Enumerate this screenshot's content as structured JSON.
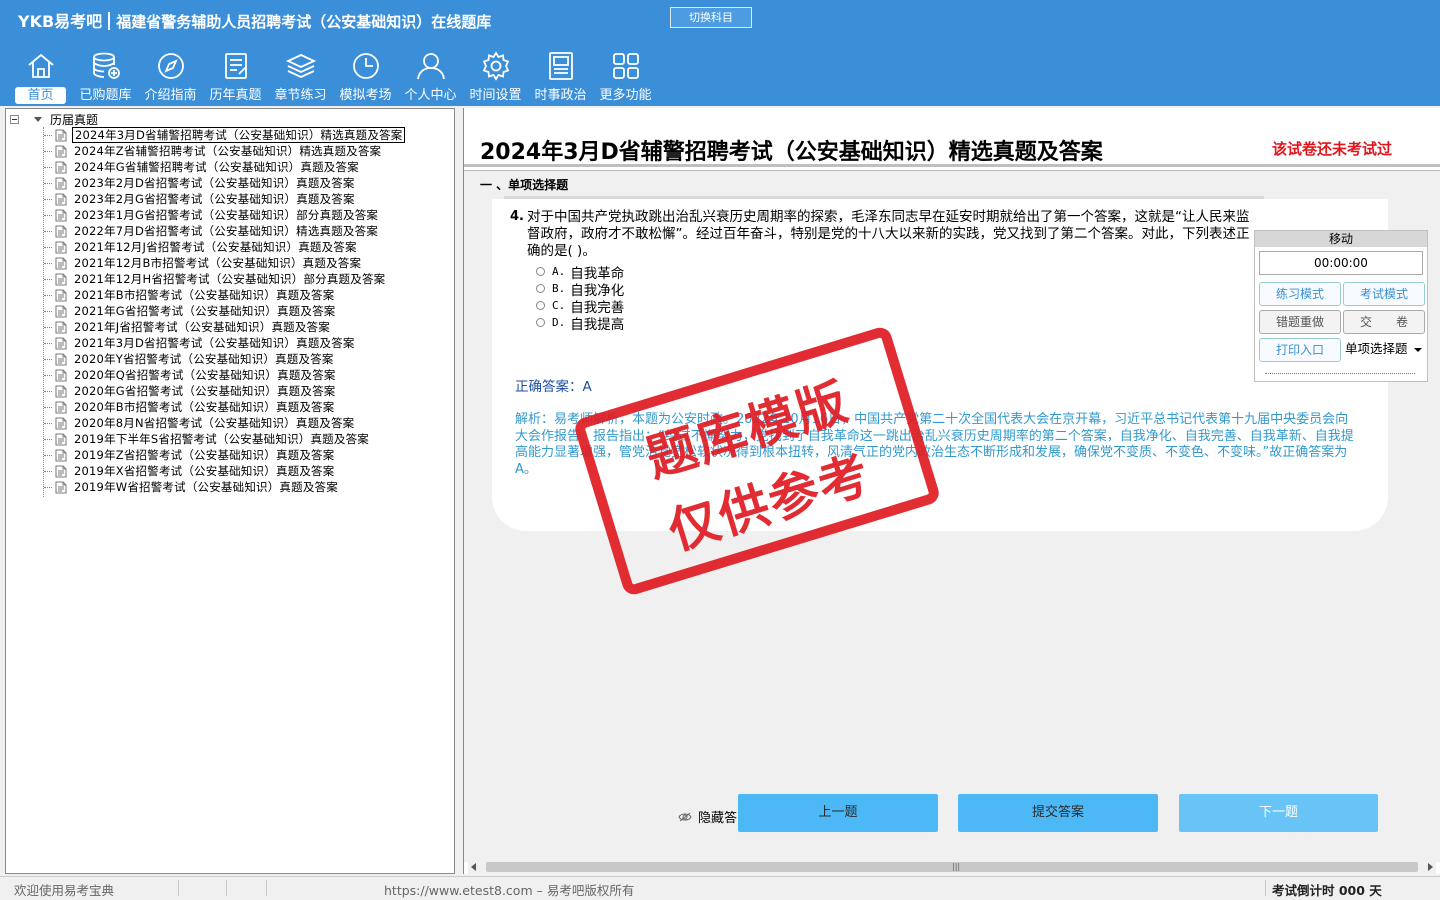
{
  "header": {
    "brand": "YKB易考吧",
    "subtitle": "福建省警务辅助人员招聘考试（公安基础知识）在线题库",
    "switch_label": "切换科目"
  },
  "nav": [
    {
      "label": "首页",
      "icon": "home-icon"
    },
    {
      "label": "已购题库",
      "icon": "database-add-icon"
    },
    {
      "label": "介绍指南",
      "icon": "compass-icon"
    },
    {
      "label": "历年真题",
      "icon": "document-list-icon"
    },
    {
      "label": "章节练习",
      "icon": "layers-icon"
    },
    {
      "label": "模拟考场",
      "icon": "clock-icon"
    },
    {
      "label": "个人中心",
      "icon": "user-icon"
    },
    {
      "label": "时间设置",
      "icon": "gear-icon"
    },
    {
      "label": "时事政治",
      "icon": "book-icon"
    },
    {
      "label": "更多功能",
      "icon": "grid-icon"
    }
  ],
  "tree": {
    "root": "历届真题",
    "items": [
      "2024年3月D省辅警招聘考试（公安基础知识）精选真题及答案",
      "2024年Z省辅警招聘考试（公安基础知识）精选真题及答案",
      "2024年G省辅警招聘考试（公安基础知识）真题及答案",
      "2023年2月D省招警考试（公安基础知识）真题及答案",
      "2023年2月G省招警考试（公安基础知识）真题及答案",
      "2023年1月G省招警考试（公安基础知识）部分真题及答案",
      "2022年7月D省招警考试（公安基础知识）精选真题及答案",
      "2021年12月J省招警考试（公安基础知识）真题及答案",
      "2021年12月B市招警考试（公安基础知识）真题及答案",
      "2021年12月H省招警考试（公安基础知识）部分真题及答案",
      "2021年B市招警考试（公安基础知识）真题及答案",
      "2021年G省招警考试（公安基础知识）真题及答案",
      "2021年J省招警考试（公安基础知识）真题及答案",
      "2021年3月D省招警考试（公安基础知识）真题及答案",
      "2020年Y省招警考试（公安基础知识）真题及答案",
      "2020年Q省招警考试（公安基础知识）真题及答案",
      "2020年G省招警考试（公安基础知识）真题及答案",
      "2020年B市招警考试（公安基础知识）真题及答案",
      "2020年8月N省招警考试（公安基础知识）真题及答案",
      "2019年下半年S省招警考试（公安基础知识）真题及答案",
      "2019年Z省招警考试（公安基础知识）真题及答案",
      "2019年X省招警考试（公安基础知识）真题及答案",
      "2019年W省招警考试（公安基础知识）真题及答案"
    ],
    "selected_index": 0
  },
  "paper": {
    "title": "2024年3月D省辅警招聘考试（公安基础知识）精选真题及答案",
    "status": "该试卷还未考试过",
    "section": "一 、单项选择题"
  },
  "question": {
    "number": "4.",
    "text": "对于中国共产党执政跳出治乱兴衰历史周期率的探索，毛泽东同志早在延安时期就给出了第一个答案，这就是“让人民来监督政府，政府才不敢松懈”。经过百年奋斗，特别是党的十八大以来新的实践，党又找到了第二个答案。对此，下列表述正确的是( )。",
    "options": [
      {
        "key": "A.",
        "text": "自我革命"
      },
      {
        "key": "B.",
        "text": "自我净化"
      },
      {
        "key": "C.",
        "text": "自我完善"
      },
      {
        "key": "D.",
        "text": "自我提高"
      }
    ],
    "answer": "正确答案：A",
    "analysis": "解析：易考师解析，本题为公安时政。2022年10月16日，中国共产党第二十次全国代表大会在京开幕，习近平总书记代表第十九届中央委员会向大会作报告。报告指出：“经过不懈努力，党找到了自我革命这一跳出治乱兴衰历史周期率的第二个答案，自我净化、自我完善、自我革新、自我提高能力显著增强，管党治党宽松软状况得到根本扭转，风清气正的党内政治生态不断形成和发展，确保党不变质、不变色、不变味。”故正确答案为A。"
  },
  "panel": {
    "move": "移动",
    "timer": "00:00:00",
    "practice": "练习模式",
    "exam": "考试模式",
    "redo": "错题重做",
    "submit": "交　　卷",
    "print": "打印入口",
    "select": "单项选择题"
  },
  "watermark": {
    "line1": "题库模版",
    "line2": "仅供参考"
  },
  "controls": {
    "hide_answer": "隐藏答",
    "prev": "上一题",
    "submit_answer": "提交答案",
    "next": "下一题"
  },
  "status": {
    "welcome": "欢迎使用易考宝典",
    "copyright": "https://www.etest8.com – 易考吧版权所有",
    "countdown": "考试倒计时 000 天"
  },
  "colors": {
    "header_bg": "#3b8fd9",
    "status_red": "#e0161d",
    "answer_blue": "#1f4fa0",
    "analysis_blue": "#3399cc",
    "button_blue": "#4db8f6"
  }
}
